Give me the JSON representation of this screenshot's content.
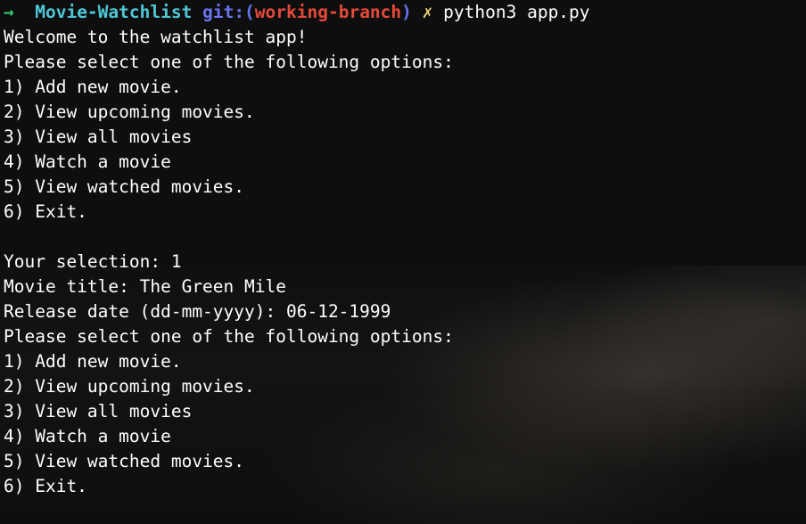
{
  "prompt": {
    "arrow": "→",
    "directory": "Movie-Watchlist",
    "git_prefix": "git:(",
    "branch": "working-branch",
    "git_suffix": ")",
    "dirty_mark": "✗",
    "command": "python3 app.py"
  },
  "output_lines": [
    "Welcome to the watchlist app!",
    "Please select one of the following options:",
    "1) Add new movie.",
    "2) View upcoming movies.",
    "3) View all movies",
    "4) Watch a movie",
    "5) View watched movies.",
    "6) Exit.",
    "",
    "Your selection: 1",
    "Movie title: The Green Mile",
    "Release date (dd-mm-yyyy): 06-12-1999",
    "Please select one of the following options:",
    "1) Add new movie.",
    "2) View upcoming movies.",
    "3) View all movies",
    "4) Watch a movie",
    "5) View watched movies.",
    "6) Exit."
  ],
  "colors": {
    "arrow": "#35c76e",
    "directory": "#4fc8d6",
    "git": "#6a74f0",
    "branch": "#e44a3a",
    "dirty": "#e8d36a",
    "text": "#ffffff"
  }
}
